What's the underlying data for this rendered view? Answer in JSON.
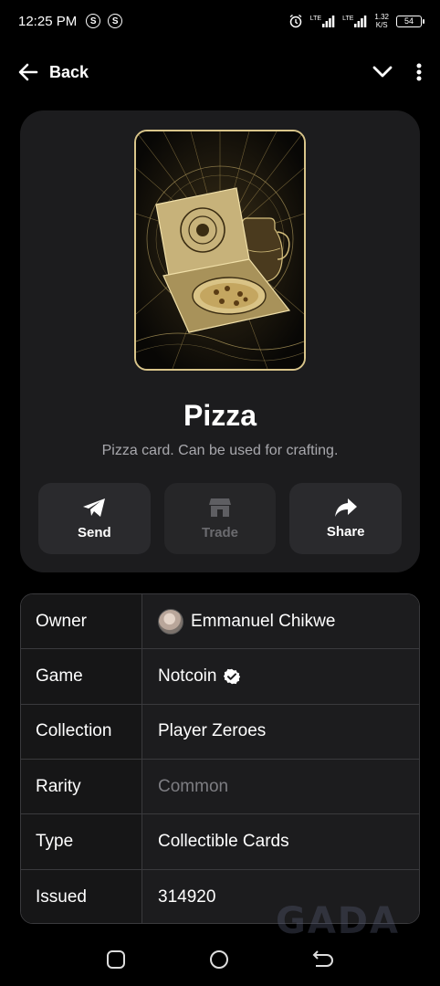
{
  "status_bar": {
    "time": "12:25 PM",
    "app_badges": [
      "S",
      "S"
    ],
    "net_labels": [
      "LTE",
      "LTE"
    ],
    "net_speed_value": "1.32",
    "net_speed_unit": "K/S",
    "battery": "54"
  },
  "top_bar": {
    "back_label": "Back",
    "icons": [
      "arrow-left-icon",
      "chevron-down-icon",
      "more-vertical-icon"
    ]
  },
  "item": {
    "title": "Pizza",
    "description": "Pizza card. Can be used for crafting."
  },
  "actions": {
    "send": "Send",
    "trade": "Trade",
    "share": "Share",
    "trade_enabled": false
  },
  "details": {
    "owner_label": "Owner",
    "owner_value": "Emmanuel Chikwe",
    "game_label": "Game",
    "game_value": "Notcoin",
    "collection_label": "Collection",
    "collection_value": "Player Zeroes",
    "rarity_label": "Rarity",
    "rarity_value": "Common",
    "type_label": "Type",
    "type_value": "Collectible Cards",
    "issued_label": "Issued",
    "issued_value": "314920"
  },
  "colors": {
    "background": "#000000",
    "panel": "#1c1c1e",
    "button": "#2a2a2d",
    "card_gold": "#d9c58a",
    "muted_text": "#a8a8ad",
    "verified_badge": "#ffffff"
  }
}
